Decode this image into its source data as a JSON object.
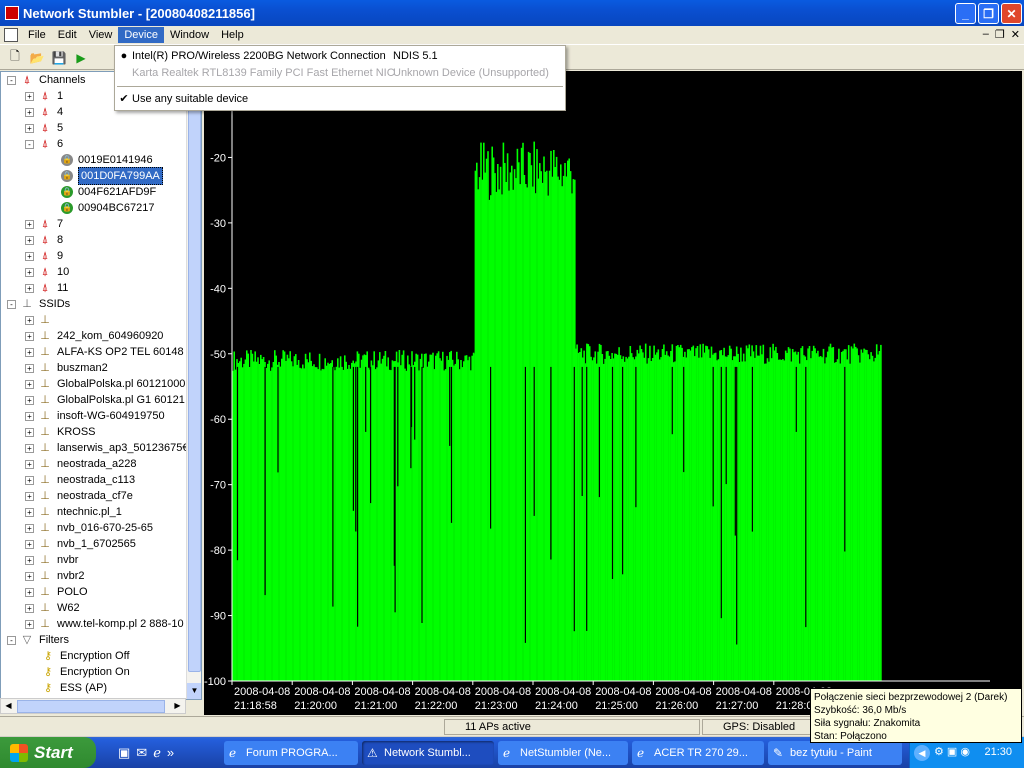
{
  "window": {
    "title": "Network Stumbler - [20080408211856]"
  },
  "menubar": {
    "items": [
      "File",
      "Edit",
      "View",
      "Device",
      "Window",
      "Help"
    ],
    "active": "Device"
  },
  "device_menu": {
    "items": [
      {
        "label": "Intel(R) PRO/Wireless 2200BG Network Connection",
        "driver": "NDIS 5.1",
        "selected": true,
        "disabled": false
      },
      {
        "label": "Karta Realtek RTL8139 Family PCI Fast Ethernet NIC",
        "driver": "Unknown Device (Unsupported)",
        "selected": false,
        "disabled": true
      }
    ],
    "auto_label": "Use any suitable device"
  },
  "tree": {
    "channels_label": "Channels",
    "channels_before": [
      "1",
      "4",
      "5"
    ],
    "open_channel": "6",
    "aps": [
      {
        "mac": "0019E0141946",
        "secured": true
      },
      {
        "mac": "001D0FA799AA",
        "secured": true,
        "selected": true
      },
      {
        "mac": "004F621AFD9F",
        "secured": false
      },
      {
        "mac": "00904BC67217",
        "secured": false
      }
    ],
    "channels_after": [
      "7",
      "8",
      "9",
      "10",
      "11"
    ],
    "ssids_label": "SSIDs",
    "ssids": [
      "",
      "242_kom_604960920",
      "ALFA-KS OP2 TEL 60148",
      "buszman2",
      "GlobalPolska.pl 60121000",
      "GlobalPolska.pl G1 60121",
      "insoft-WG-604919750",
      "KROSS",
      "lanserwis_ap3_50123675€",
      "neostrada_a228",
      "neostrada_c113",
      "neostrada_cf7e",
      "ntechnic.pl_1",
      "nvb_016-670-25-65",
      "nvb_1_6702565",
      "nvbr",
      "nvbr2",
      "POLO",
      "W62",
      "www.tel-komp.pl 2 888-10"
    ],
    "filters_label": "Filters",
    "filters": [
      "Encryption Off",
      "Encryption On",
      "ESS (AP)"
    ]
  },
  "chart_data": {
    "type": "bar",
    "ylim": [
      -100,
      -10
    ],
    "yticks": [
      -20,
      -30,
      -40,
      -50,
      -60,
      -70,
      -80,
      -90,
      -100
    ],
    "ytick_labels": [
      "-20",
      "-30",
      "-40",
      "-50",
      "-60",
      "-70",
      "-80",
      "-90",
      "-100"
    ],
    "xtick_labels": [
      [
        "2008-04-08",
        "21:18:58"
      ],
      [
        "2008-04-08",
        "21:20:00"
      ],
      [
        "2008-04-08",
        "21:21:00"
      ],
      [
        "2008-04-08",
        "21:22:00"
      ],
      [
        "2008-04-08",
        "21:23:00"
      ],
      [
        "2008-04-08",
        "21:24:00"
      ],
      [
        "2008-04-08",
        "21:25:00"
      ],
      [
        "2008-04-08",
        "21:26:00"
      ],
      [
        "2008-04-08",
        "21:27:00"
      ],
      [
        "2008-04-08",
        "21:28:0"
      ]
    ],
    "segments": [
      {
        "from": "21:18:58",
        "to": "21:23:00",
        "signal_dbm": -51
      },
      {
        "from": "21:23:00",
        "to": "21:24:40",
        "signal_dbm": -22
      },
      {
        "from": "21:24:40",
        "to": "21:29:45",
        "signal_dbm": -50
      }
    ],
    "bar_color": "#00ff00",
    "background": "#000000"
  },
  "status": {
    "aps_active": "11 APs active",
    "gps": "GPS: Disabled"
  },
  "tooltip": {
    "lines": [
      "Połączenie sieci bezprzewodowej 2 (Darek)",
      "Szybkość: 36,0 Mb/s",
      "Siła sygnału: Znakomita",
      "Stan: Połączono"
    ]
  },
  "taskbar": {
    "start": "Start",
    "tasks": [
      "Forum PROGRA...",
      "Network Stumbl...",
      "NetStumbler (Ne...",
      "ACER TR 270 29...",
      "bez tytułu - Paint"
    ],
    "active_task": 1,
    "clock": "21:30"
  }
}
